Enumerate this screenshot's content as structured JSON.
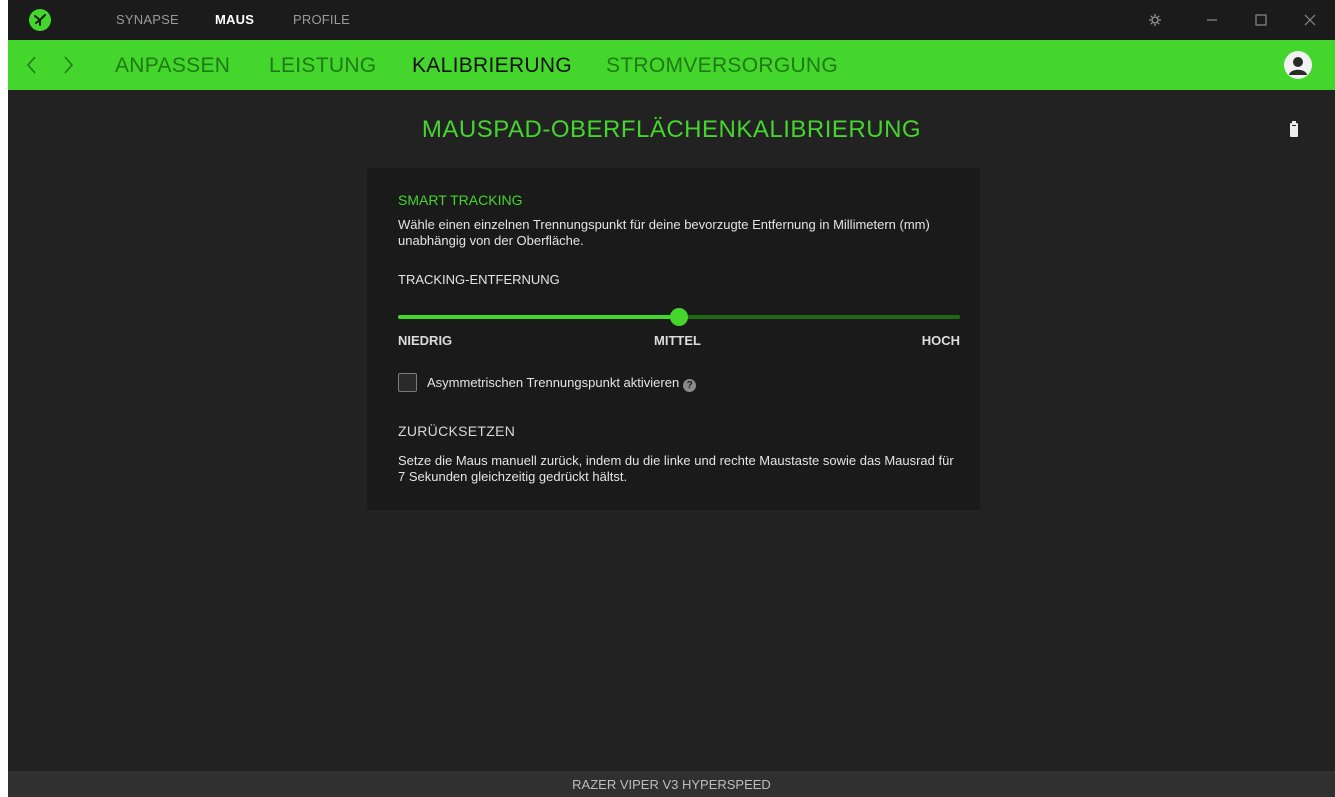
{
  "topnav": {
    "items": [
      {
        "label": "SYNAPSE"
      },
      {
        "label": "MAUS"
      },
      {
        "label": "PROFILE"
      }
    ]
  },
  "subnav": {
    "items": [
      {
        "label": "ANPASSEN"
      },
      {
        "label": "LEISTUNG"
      },
      {
        "label": "KALIBRIERUNG"
      },
      {
        "label": "STROMVERSORGUNG"
      }
    ]
  },
  "main": {
    "title": "MAUSPAD-OBERFLÄCHENKALIBRIERUNG",
    "smart_tracking": {
      "heading": "SMART TRACKING",
      "description": "Wähle einen einzelnen Trennungspunkt für deine bevorzugte Entfernung in Millimetern (mm) unabhängig von der Oberfläche.",
      "distance_label": "TRACKING-ENTFERNUNG",
      "slider_value": 0.5,
      "low_label": "NIEDRIG",
      "mid_label": "MITTEL",
      "high_label": "HOCH",
      "asymmetric_label": "Asymmetrischen Trennungspunkt aktivieren",
      "asymmetric_checked": false
    },
    "reset": {
      "heading": "ZURÜCKSETZEN",
      "description": "Setze die Maus manuell zurück, indem du die linke und rechte Maustaste sowie das Mausrad für 7 Sekunden gleichzeitig gedrückt hältst."
    }
  },
  "statusbar": {
    "device": "RAZER VIPER V3 HYPERSPEED"
  },
  "colors": {
    "accent": "#44d62c",
    "background": "#222222",
    "card": "#1a1a1a"
  },
  "icons": {
    "logo": "razer-logo-icon",
    "settings": "gear-icon",
    "minimize": "minimize-icon",
    "maximize": "maximize-icon",
    "close": "close-icon",
    "back": "chevron-left-icon",
    "forward": "chevron-right-icon",
    "account": "user-avatar-icon",
    "battery": "battery-icon",
    "help": "help-icon"
  }
}
